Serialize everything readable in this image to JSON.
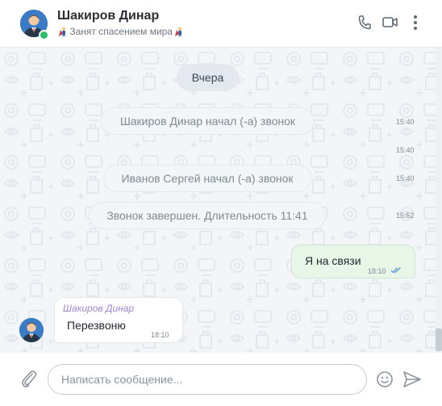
{
  "header": {
    "name": "Шакиров Динар",
    "status": "Занят спасением мира",
    "icons": [
      "phone-icon",
      "video-camera-icon",
      "more-vertical-icon"
    ]
  },
  "chat": {
    "date_divider": "Вчера",
    "events": [
      {
        "text": "Шакиров Динар начал (-а) звонок",
        "time": "15:40"
      },
      {
        "text": "",
        "time": "15:40"
      },
      {
        "text": "Иванов Сергей начал (-а) звонок",
        "time": "15:40"
      },
      {
        "text": "Звонок завершен. Длительность 11:41",
        "time": "15:52"
      }
    ],
    "outgoing": {
      "text": "Я на связи",
      "time": "18:10"
    },
    "incoming": {
      "sender": "Шакиров Динар",
      "text": "Перезвоню",
      "time": "18:10"
    }
  },
  "composer": {
    "placeholder": "Написать сообщение...",
    "value": ""
  },
  "colors": {
    "online": "#2bbf6a",
    "sender_name": "#a086d6",
    "outgoing_bubble": "#e7f6e7",
    "read_checks": "#4a90d9"
  }
}
